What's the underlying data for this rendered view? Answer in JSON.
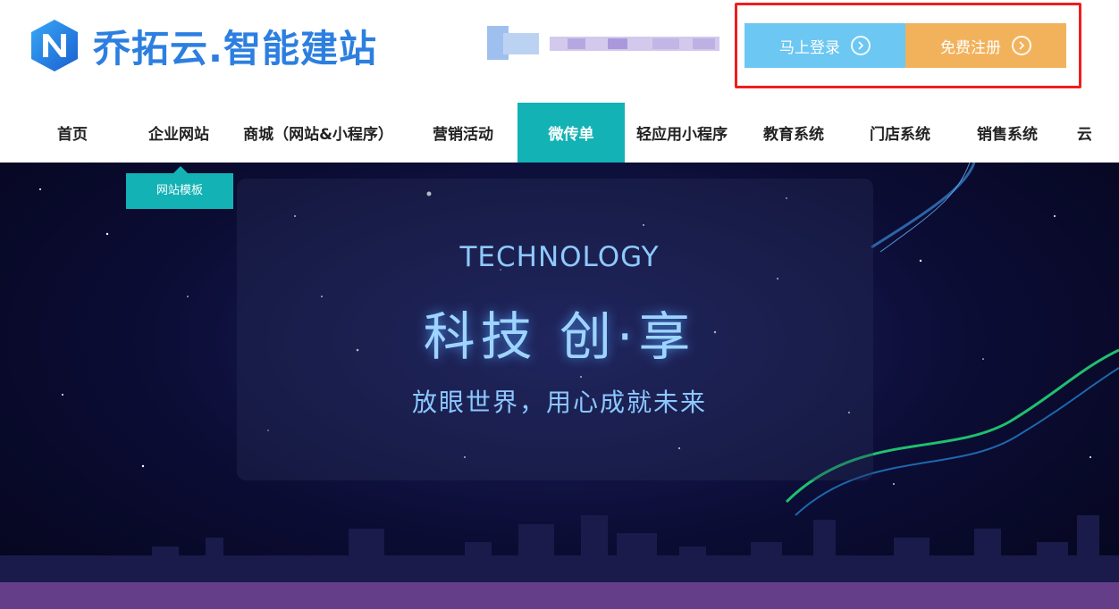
{
  "header": {
    "logo_text": "乔拓云.智能建站",
    "login_label": "马上登录",
    "register_label": "免费注册"
  },
  "nav": {
    "items": [
      {
        "label": "首页"
      },
      {
        "label": "企业网站"
      },
      {
        "label": "商城（网站&小程序）"
      },
      {
        "label": "营销活动"
      },
      {
        "label": "微传单",
        "active": true
      },
      {
        "label": "轻应用小程序"
      },
      {
        "label": "教育系统"
      },
      {
        "label": "门店系统"
      },
      {
        "label": "销售系统"
      },
      {
        "label": "云"
      }
    ],
    "dropdown_label": "网站模板"
  },
  "hero": {
    "eyebrow": "TECHNOLOGY",
    "headline": "科技 创·享",
    "subline": "放眼世界，用心成就未来"
  },
  "colors": {
    "brand_blue": "#2c7fe0",
    "teal": "#12b2b5",
    "login_bg": "#6cc7f2",
    "register_bg": "#f2b25c",
    "highlight_border": "#f21d1d"
  },
  "icons": {
    "logo": "n-logo-icon",
    "arrow": "chevron-right-circle-icon"
  }
}
